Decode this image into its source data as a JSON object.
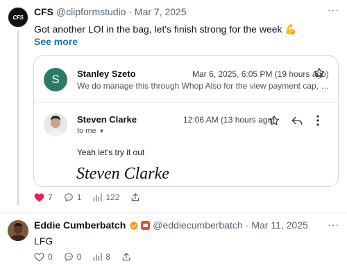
{
  "post1": {
    "avatar_text": "CFS",
    "display_name": "CFS",
    "handle": "@clipformstudio",
    "separator": "·",
    "date": "Mar 7, 2025",
    "text": "Got another LOI in the bag, let's finish strong for the week 💪",
    "see_more": "See more",
    "more_menu": "···",
    "actions": {
      "likes": "7",
      "replies": "1",
      "views": "122"
    },
    "liked": true,
    "like_color": "#e0245e"
  },
  "card": {
    "email1": {
      "avatar_letter": "S",
      "avatar_color": "#2d7a67",
      "sender": "Stanley Szeto",
      "date": "Mar 6, 2025, 6:05 PM (19 hours ago)",
      "snippet": "We do manage this through Whop Also for the view payment cap, we set t..."
    },
    "email2": {
      "sender": "Steven Clarke",
      "to": "to me",
      "time": "12:06 AM (13 hours ago)",
      "body": "Yeah let's try it out",
      "signature": "Steven Clarke"
    }
  },
  "post2": {
    "display_name": "Eddie Cumberbatch",
    "handle": "@eddiecumberbatch",
    "separator": "·",
    "date": "Mar 11, 2025",
    "text": "LFG",
    "more_menu": "···",
    "verified_color": "#f29b1d",
    "actions": {
      "likes": "0",
      "replies": "0",
      "views": "8"
    }
  }
}
